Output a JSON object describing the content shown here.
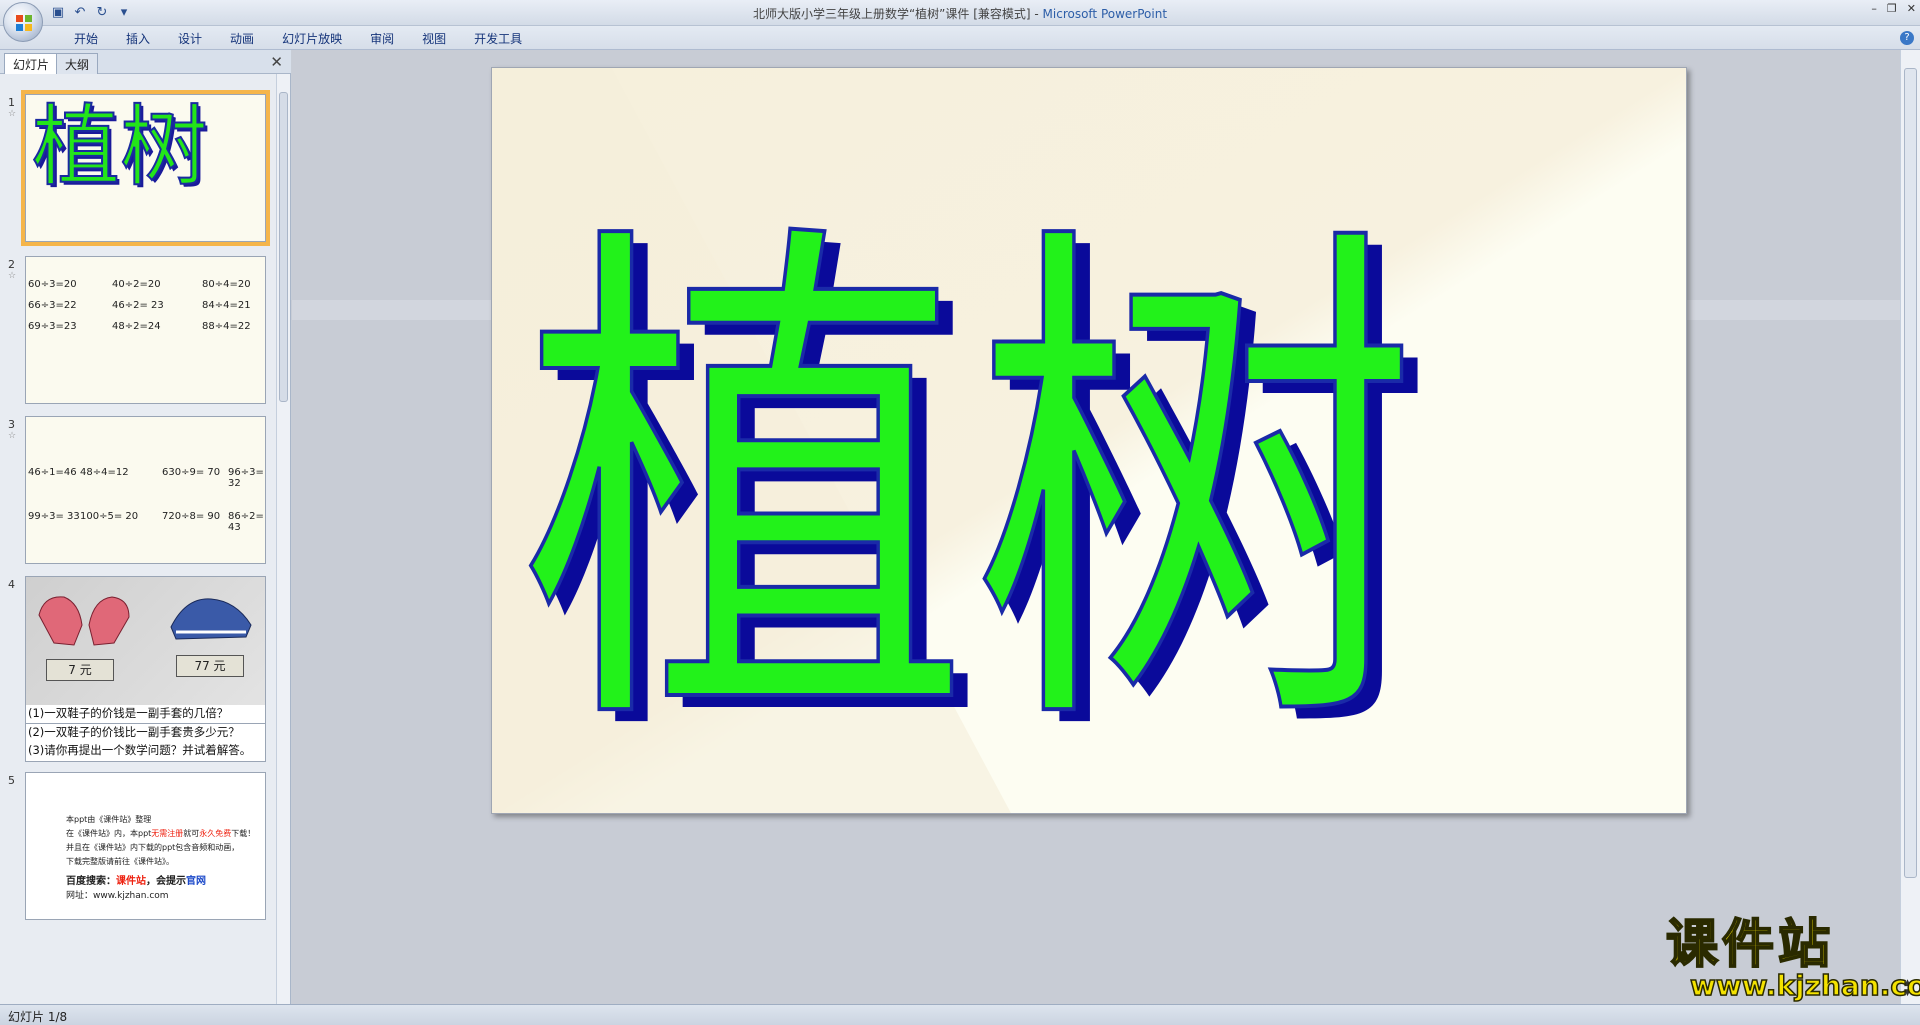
{
  "window": {
    "title": "北师大版小学三年级上册数学“植树”课件 [兼容模式] - ",
    "app_name": "Microsoft PowerPoint"
  },
  "qat": {
    "save_icon": "save-icon",
    "undo_icon": "undo-icon",
    "redo_icon": "redo-icon",
    "customize_icon": "dropdown-icon"
  },
  "ribbon": {
    "tabs": [
      "开始",
      "插入",
      "设计",
      "动画",
      "幻灯片放映",
      "审阅",
      "视图",
      "开发工具"
    ]
  },
  "panel": {
    "tab_slides": "幻灯片",
    "tab_outline": "大纲",
    "close": "✕"
  },
  "thumbnails": [
    {
      "num": "1",
      "title": "植树"
    },
    {
      "num": "2",
      "cells": [
        "60÷3=20",
        "40÷2=20",
        "80÷4=20",
        "66÷3=22",
        "46÷2= 23",
        "84÷4=21",
        "69÷3=23",
        "48÷2=24",
        "88÷4=22"
      ]
    },
    {
      "num": "3",
      "cells": [
        "46÷1=46",
        "48÷4=12",
        "630÷9= 70",
        "96÷3= 32",
        "99÷3= 33",
        "100÷5= 20",
        "720÷8= 90",
        "86÷2= 43"
      ]
    },
    {
      "num": "4",
      "price1": "7 元",
      "price2": "77 元",
      "questions": [
        "(1)一双鞋子的价钱是一副手套的几倍？",
        "(2)一双鞋子的价钱比一副手套贵多少元？",
        "(3)请你再提出一个数学问题？并试着解答。"
      ]
    },
    {
      "num": "5",
      "lines": {
        "l1": "本ppt由《课件站》整理",
        "l2a": "在《课件站》内，本ppt",
        "l2b": "无需注册",
        "l2c": "就可",
        "l2d": "永久免费",
        "l2e": "下载！",
        "l3": "并且在《课件站》内下载的ppt包含音频和动画，",
        "l4": "下载完整版请前往《课件站》。",
        "l5a": "百度搜索：",
        "l5b": "课件站",
        "l5c": "，会提示",
        "l5d": "官网",
        "l6": "网址：www.kjzhan.com"
      }
    }
  ],
  "slide": {
    "title": "植树"
  },
  "status": {
    "text": "幻灯片 1/8"
  },
  "watermark": {
    "cn": "课件站",
    "url": "www.kjzhan.com"
  }
}
